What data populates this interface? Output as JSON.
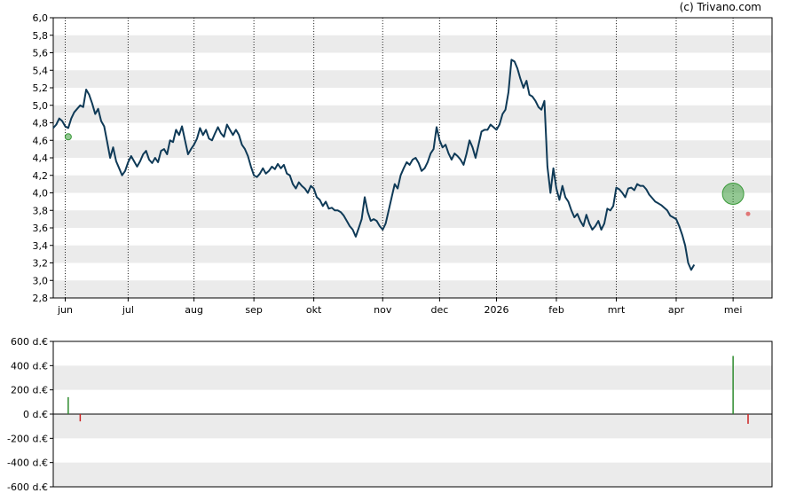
{
  "credit": "(c) Trivano.com",
  "colors": {
    "price_line": "#0f3a57",
    "band": "#ebebeb",
    "buy": "#2e8b2e",
    "sell": "#cc2222",
    "buy_marker": "#3a9a3a",
    "sell_marker": "#dd4444"
  },
  "chart_data": [
    {
      "type": "line",
      "name": "price",
      "ylim": [
        2.8,
        6.0
      ],
      "y_ticks": [
        "2,8",
        "3,0",
        "3,2",
        "3,4",
        "3,6",
        "3,8",
        "4,0",
        "4,2",
        "4,4",
        "4,6",
        "4,8",
        "5,0",
        "5,2",
        "5,4",
        "5,6",
        "5,8",
        "6,0"
      ],
      "x_range": [
        0,
        240
      ],
      "x_ticks": [
        {
          "x": 4,
          "label": "jun"
        },
        {
          "x": 25,
          "label": "jul"
        },
        {
          "x": 47,
          "label": "aug"
        },
        {
          "x": 67,
          "label": "sep"
        },
        {
          "x": 87,
          "label": "okt"
        },
        {
          "x": 110,
          "label": "nov"
        },
        {
          "x": 129,
          "label": "dec"
        },
        {
          "x": 148,
          "label": "2026"
        },
        {
          "x": 168,
          "label": "feb"
        },
        {
          "x": 188,
          "label": "mrt"
        },
        {
          "x": 208,
          "label": "apr"
        },
        {
          "x": 227,
          "label": "mei"
        }
      ],
      "grid": "alternating horizontal bands, dotted vertical lines at month starts",
      "series": [
        {
          "points": [
            [
              0,
              4.74
            ],
            [
              1,
              4.78
            ],
            [
              2,
              4.85
            ],
            [
              3,
              4.82
            ],
            [
              4,
              4.76
            ],
            [
              5,
              4.74
            ],
            [
              6,
              4.85
            ],
            [
              7,
              4.92
            ],
            [
              8,
              4.96
            ],
            [
              9,
              5.0
            ],
            [
              10,
              4.98
            ],
            [
              11,
              5.18
            ],
            [
              12,
              5.12
            ],
            [
              13,
              5.02
            ],
            [
              14,
              4.9
            ],
            [
              15,
              4.96
            ],
            [
              16,
              4.82
            ],
            [
              17,
              4.76
            ],
            [
              18,
              4.58
            ],
            [
              19,
              4.4
            ],
            [
              20,
              4.52
            ],
            [
              21,
              4.36
            ],
            [
              22,
              4.28
            ],
            [
              23,
              4.2
            ],
            [
              24,
              4.25
            ],
            [
              25,
              4.35
            ],
            [
              26,
              4.42
            ],
            [
              27,
              4.36
            ],
            [
              28,
              4.3
            ],
            [
              29,
              4.36
            ],
            [
              30,
              4.44
            ],
            [
              31,
              4.48
            ],
            [
              32,
              4.38
            ],
            [
              33,
              4.34
            ],
            [
              34,
              4.4
            ],
            [
              35,
              4.35
            ],
            [
              36,
              4.48
            ],
            [
              37,
              4.5
            ],
            [
              38,
              4.44
            ],
            [
              39,
              4.6
            ],
            [
              40,
              4.58
            ],
            [
              41,
              4.72
            ],
            [
              42,
              4.66
            ],
            [
              43,
              4.76
            ],
            [
              44,
              4.6
            ],
            [
              45,
              4.44
            ],
            [
              46,
              4.5
            ],
            [
              47,
              4.55
            ],
            [
              48,
              4.62
            ],
            [
              49,
              4.74
            ],
            [
              50,
              4.66
            ],
            [
              51,
              4.72
            ],
            [
              52,
              4.62
            ],
            [
              53,
              4.6
            ],
            [
              54,
              4.68
            ],
            [
              55,
              4.75
            ],
            [
              56,
              4.68
            ],
            [
              57,
              4.64
            ],
            [
              58,
              4.78
            ],
            [
              59,
              4.72
            ],
            [
              60,
              4.66
            ],
            [
              61,
              4.72
            ],
            [
              62,
              4.66
            ],
            [
              63,
              4.55
            ],
            [
              64,
              4.5
            ],
            [
              65,
              4.42
            ],
            [
              66,
              4.3
            ],
            [
              67,
              4.2
            ],
            [
              68,
              4.18
            ],
            [
              69,
              4.22
            ],
            [
              70,
              4.28
            ],
            [
              71,
              4.22
            ],
            [
              72,
              4.25
            ],
            [
              73,
              4.3
            ],
            [
              74,
              4.27
            ],
            [
              75,
              4.33
            ],
            [
              76,
              4.28
            ],
            [
              77,
              4.32
            ],
            [
              78,
              4.22
            ],
            [
              79,
              4.2
            ],
            [
              80,
              4.1
            ],
            [
              81,
              4.05
            ],
            [
              82,
              4.12
            ],
            [
              83,
              4.08
            ],
            [
              84,
              4.05
            ],
            [
              85,
              4.0
            ],
            [
              86,
              4.08
            ],
            [
              87,
              4.05
            ],
            [
              88,
              3.95
            ],
            [
              89,
              3.92
            ],
            [
              90,
              3.85
            ],
            [
              91,
              3.9
            ],
            [
              92,
              3.82
            ],
            [
              93,
              3.83
            ],
            [
              94,
              3.8
            ],
            [
              95,
              3.8
            ],
            [
              96,
              3.78
            ],
            [
              97,
              3.74
            ],
            [
              98,
              3.68
            ],
            [
              99,
              3.62
            ],
            [
              100,
              3.58
            ],
            [
              101,
              3.5
            ],
            [
              102,
              3.6
            ],
            [
              103,
              3.7
            ],
            [
              104,
              3.95
            ],
            [
              105,
              3.78
            ],
            [
              106,
              3.68
            ],
            [
              107,
              3.7
            ],
            [
              108,
              3.68
            ],
            [
              109,
              3.62
            ],
            [
              110,
              3.58
            ],
            [
              111,
              3.65
            ],
            [
              112,
              3.8
            ],
            [
              113,
              3.95
            ],
            [
              114,
              4.1
            ],
            [
              115,
              4.05
            ],
            [
              116,
              4.2
            ],
            [
              117,
              4.28
            ],
            [
              118,
              4.35
            ],
            [
              119,
              4.32
            ],
            [
              120,
              4.38
            ],
            [
              121,
              4.4
            ],
            [
              122,
              4.34
            ],
            [
              123,
              4.25
            ],
            [
              124,
              4.28
            ],
            [
              125,
              4.35
            ],
            [
              126,
              4.45
            ],
            [
              127,
              4.5
            ],
            [
              128,
              4.75
            ],
            [
              129,
              4.6
            ],
            [
              130,
              4.52
            ],
            [
              131,
              4.55
            ],
            [
              132,
              4.45
            ],
            [
              133,
              4.38
            ],
            [
              134,
              4.45
            ],
            [
              135,
              4.42
            ],
            [
              136,
              4.38
            ],
            [
              137,
              4.32
            ],
            [
              138,
              4.45
            ],
            [
              139,
              4.6
            ],
            [
              140,
              4.52
            ],
            [
              141,
              4.4
            ],
            [
              142,
              4.55
            ],
            [
              143,
              4.7
            ],
            [
              144,
              4.72
            ],
            [
              145,
              4.72
            ],
            [
              146,
              4.78
            ],
            [
              147,
              4.75
            ],
            [
              148,
              4.72
            ],
            [
              149,
              4.78
            ],
            [
              150,
              4.9
            ],
            [
              151,
              4.95
            ],
            [
              152,
              5.15
            ],
            [
              153,
              5.52
            ],
            [
              154,
              5.5
            ],
            [
              155,
              5.42
            ],
            [
              156,
              5.3
            ],
            [
              157,
              5.2
            ],
            [
              158,
              5.28
            ],
            [
              159,
              5.12
            ],
            [
              160,
              5.1
            ],
            [
              161,
              5.05
            ],
            [
              162,
              4.98
            ],
            [
              163,
              4.95
            ],
            [
              164,
              5.05
            ],
            [
              165,
              4.3
            ],
            [
              166,
              4.0
            ],
            [
              167,
              4.28
            ],
            [
              168,
              4.05
            ],
            [
              169,
              3.92
            ],
            [
              170,
              4.08
            ],
            [
              171,
              3.95
            ],
            [
              172,
              3.9
            ],
            [
              173,
              3.8
            ],
            [
              174,
              3.72
            ],
            [
              175,
              3.76
            ],
            [
              176,
              3.68
            ],
            [
              177,
              3.62
            ],
            [
              178,
              3.75
            ],
            [
              179,
              3.65
            ],
            [
              180,
              3.58
            ],
            [
              181,
              3.62
            ],
            [
              182,
              3.68
            ],
            [
              183,
              3.58
            ],
            [
              184,
              3.65
            ],
            [
              185,
              3.82
            ],
            [
              186,
              3.8
            ],
            [
              187,
              3.85
            ],
            [
              188,
              4.06
            ],
            [
              189,
              4.04
            ],
            [
              190,
              4.0
            ],
            [
              191,
              3.95
            ],
            [
              192,
              4.05
            ],
            [
              193,
              4.06
            ],
            [
              194,
              4.03
            ],
            [
              195,
              4.1
            ],
            [
              196,
              4.08
            ],
            [
              197,
              4.08
            ],
            [
              198,
              4.04
            ],
            [
              199,
              3.98
            ],
            [
              200,
              3.94
            ],
            [
              201,
              3.9
            ],
            [
              202,
              3.88
            ],
            [
              203,
              3.86
            ],
            [
              204,
              3.83
            ],
            [
              205,
              3.8
            ],
            [
              206,
              3.74
            ],
            [
              207,
              3.72
            ],
            [
              208,
              3.7
            ],
            [
              209,
              3.62
            ],
            [
              210,
              3.52
            ],
            [
              211,
              3.4
            ],
            [
              212,
              3.2
            ],
            [
              213,
              3.12
            ],
            [
              214,
              3.18
            ]
          ]
        }
      ],
      "annotations": [
        {
          "type": "buy",
          "x": 5,
          "y": 4.64,
          "size": "small"
        },
        {
          "type": "buy",
          "x": 227,
          "y": 3.99,
          "size": "large"
        },
        {
          "type": "sell",
          "x": 232,
          "y": 3.76,
          "size": "small"
        }
      ]
    },
    {
      "type": "bar",
      "name": "insider transactions",
      "ylim": [
        -600,
        600
      ],
      "y_ticks": [
        "600 d.€",
        "400 d.€",
        "200 d.€",
        "0 d.€",
        "-200 d.€",
        "-400 d.€",
        "-600 d.€"
      ],
      "values": [
        {
          "x": 5,
          "value": 140
        },
        {
          "x": 9,
          "value": -60
        },
        {
          "x": 227,
          "value": 480
        },
        {
          "x": 232,
          "value": -80
        }
      ]
    }
  ]
}
